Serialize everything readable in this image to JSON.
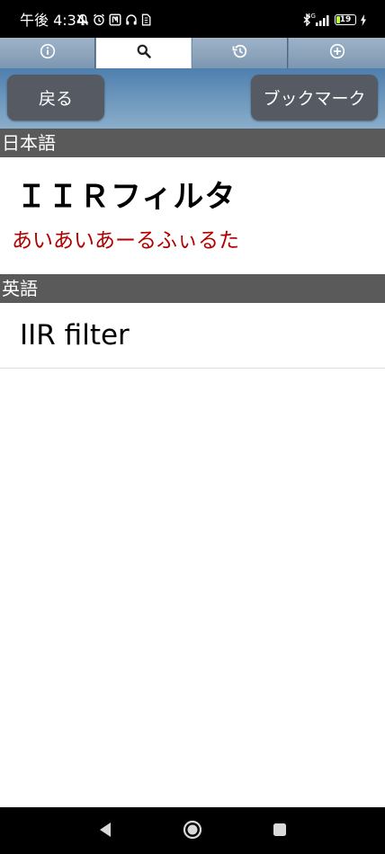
{
  "status_bar": {
    "time": "午後 4:34",
    "network": "4G",
    "battery": "19",
    "battery_level": 0.19,
    "icons": [
      "mute-icon",
      "alarm-icon",
      "nfc-icon",
      "headphones-icon",
      "sim-icon",
      "bluetooth-icon",
      "signal-icon",
      "battery-icon",
      "charging-icon"
    ]
  },
  "tabs": [
    {
      "icon": "info-icon",
      "active": false
    },
    {
      "icon": "search-icon",
      "active": true
    },
    {
      "icon": "history-icon",
      "active": false
    },
    {
      "icon": "add-icon",
      "active": false
    }
  ],
  "toolbar": {
    "back_label": "戻る",
    "bookmark_label": "ブックマーク"
  },
  "entry": {
    "japanese_header": "日本語",
    "term": "ＩＩＲフィルタ",
    "reading": "あいあいあーるふぃるた",
    "english_header": "英語",
    "english_term": "IIR filter"
  },
  "colors": {
    "section_header_bg": "#5a5a5a",
    "reading_color": "#b20000",
    "button_bg": "#555a63",
    "toolbar_top": "#4f7fae",
    "toolbar_bottom": "#8aaecb"
  },
  "nav_bar": {
    "icons": [
      "back-icon",
      "home-icon",
      "recents-icon"
    ]
  }
}
